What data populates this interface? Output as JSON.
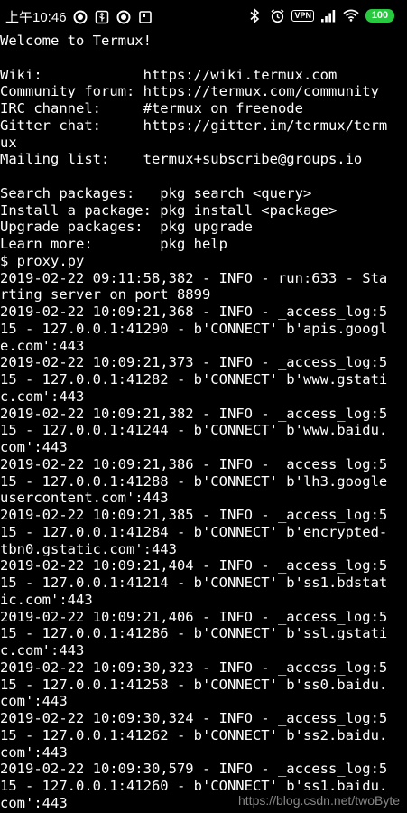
{
  "status_bar": {
    "time": "上午10:46",
    "left_icons": [
      "record-icon",
      "usb-icon",
      "record-icon",
      "screenshot-icon"
    ],
    "right_icons": [
      "bluetooth-icon",
      "alarm-icon",
      "vpn-icon",
      "signal-icon",
      "wifi-icon"
    ],
    "vpn_label": "VPN",
    "battery_level": "100",
    "battery_color": "#27c93f"
  },
  "terminal": {
    "lines": [
      "Welcome to Termux!",
      "",
      "Wiki:            https://wiki.termux.com",
      "Community forum: https://termux.com/community",
      "IRC channel:     #termux on freenode",
      "Gitter chat:     https://gitter.im/termux/term",
      "ux",
      "Mailing list:    termux+subscribe@groups.io",
      "",
      "Search packages:   pkg search <query>",
      "Install a package: pkg install <package>",
      "Upgrade packages:  pkg upgrade",
      "Learn more:        pkg help",
      "$ proxy.py",
      "2019-02-22 09:11:58,382 - INFO - run:633 - Sta",
      "rting server on port 8899",
      "2019-02-22 10:09:21,368 - INFO - _access_log:5",
      "15 - 127.0.0.1:41290 - b'CONNECT' b'apis.googl",
      "e.com':443",
      "2019-02-22 10:09:21,373 - INFO - _access_log:5",
      "15 - 127.0.0.1:41282 - b'CONNECT' b'www.gstati",
      "c.com':443",
      "2019-02-22 10:09:21,382 - INFO - _access_log:5",
      "15 - 127.0.0.1:41244 - b'CONNECT' b'www.baidu.",
      "com':443",
      "2019-02-22 10:09:21,386 - INFO - _access_log:5",
      "15 - 127.0.0.1:41288 - b'CONNECT' b'lh3.google",
      "usercontent.com':443",
      "2019-02-22 10:09:21,385 - INFO - _access_log:5",
      "15 - 127.0.0.1:41284 - b'CONNECT' b'encrypted-",
      "tbn0.gstatic.com':443",
      "2019-02-22 10:09:21,404 - INFO - _access_log:5",
      "15 - 127.0.0.1:41214 - b'CONNECT' b'ss1.bdstat",
      "ic.com':443",
      "2019-02-22 10:09:21,406 - INFO - _access_log:5",
      "15 - 127.0.0.1:41286 - b'CONNECT' b'ssl.gstati",
      "c.com':443",
      "2019-02-22 10:09:30,323 - INFO - _access_log:5",
      "15 - 127.0.0.1:41258 - b'CONNECT' b'ss0.baidu.",
      "com':443",
      "2019-02-22 10:09:30,324 - INFO - _access_log:5",
      "15 - 127.0.0.1:41262 - b'CONNECT' b'ss2.baidu.",
      "com':443",
      "2019-02-22 10:09:30,579 - INFO - _access_log:5",
      "15 - 127.0.0.1:41260 - b'CONNECT' b'ss1.baidu.",
      "com':443"
    ],
    "text_color": "#ffffff",
    "background_color": "#000000"
  },
  "watermark": {
    "text": "https://blog.csdn.net/twoByte"
  }
}
